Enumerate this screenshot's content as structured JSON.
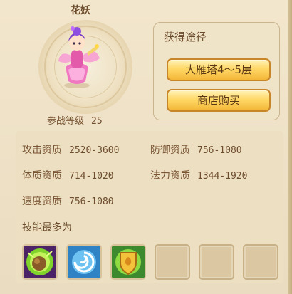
{
  "pet": {
    "name": "花妖",
    "level_label": "参战等级",
    "level_value": "25"
  },
  "obtain": {
    "title": "获得途径",
    "buttons": [
      "大雁塔4～5层",
      "商店购买"
    ]
  },
  "stats": [
    {
      "label": "攻击资质",
      "value": "2520-3600"
    },
    {
      "label": "防御资质",
      "value": "756-1080"
    },
    {
      "label": "体质资质",
      "value": "714-1020"
    },
    {
      "label": "法力资质",
      "value": "1344-1920"
    },
    {
      "label": "速度资质",
      "value": "756-1080"
    }
  ],
  "skills": {
    "label": "技能最多为",
    "icons": [
      "boulder-skill-icon",
      "whirlwind-skill-icon",
      "shield-skill-icon"
    ],
    "empty_slots": 3
  },
  "colors": {
    "button_gold": "#ffd866",
    "panel": "#efe3c8",
    "text_brown": "#7a5634"
  }
}
